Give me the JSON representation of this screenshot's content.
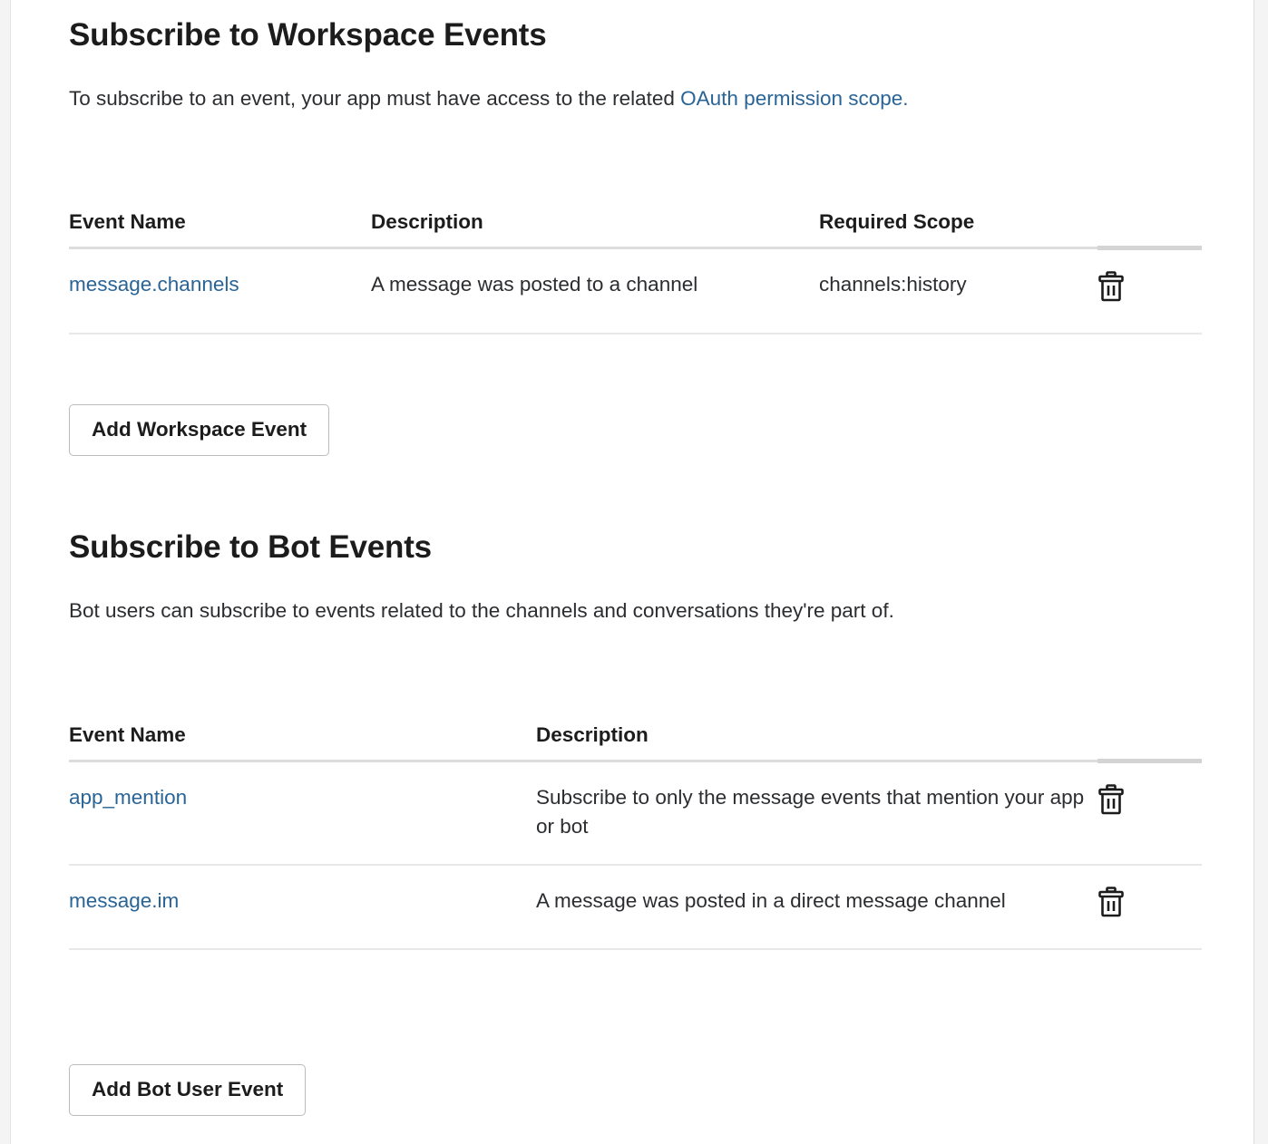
{
  "colors": {
    "link": "#2a6496",
    "text": "#2c2d30",
    "heading": "#1d1c1d",
    "rule": "#dddddd",
    "button_border": "#bbbbbb"
  },
  "workspace_section": {
    "title": "Subscribe to Workspace Events",
    "description_prefix": "To subscribe to an event, your app must have access to the related ",
    "description_link": "OAuth permission scope.",
    "table": {
      "columns": [
        "Event Name",
        "Description",
        "Required Scope",
        ""
      ],
      "rows": [
        {
          "event_name": "message.channels",
          "description": "A message was posted to a channel",
          "required_scope": "channels:history",
          "delete_icon": "trash-icon"
        }
      ]
    },
    "add_button_label": "Add Workspace Event"
  },
  "bot_section": {
    "title": "Subscribe to Bot Events",
    "description": "Bot users can subscribe to events related to the channels and conversations they're part of.",
    "table": {
      "columns": [
        "Event Name",
        "Description",
        ""
      ],
      "rows": [
        {
          "event_name": "app_mention",
          "description": "Subscribe to only the message events that mention your app or bot",
          "delete_icon": "trash-icon"
        },
        {
          "event_name": "message.im",
          "description": "A message was posted in a direct message channel",
          "delete_icon": "trash-icon"
        }
      ]
    },
    "add_button_label": "Add Bot User Event"
  }
}
